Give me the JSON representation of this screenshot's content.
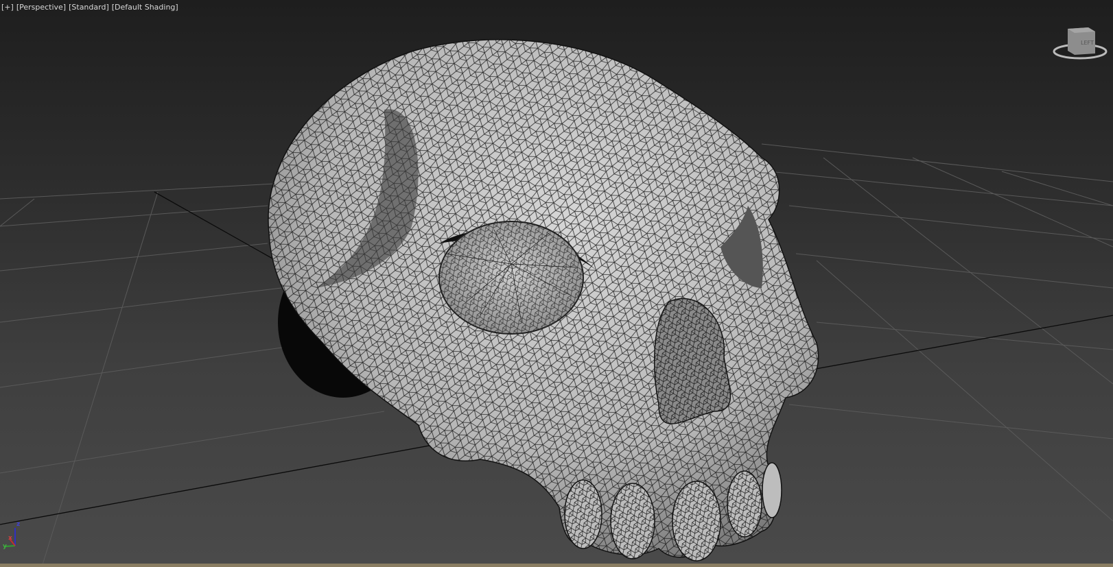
{
  "viewport": {
    "labels": [
      "[+]",
      "[Perspective]",
      "[Standard]",
      "[Default Shading]"
    ],
    "viewcube_face": "LEFT",
    "axis_labels": {
      "x": "x",
      "y": "y",
      "z": "z"
    }
  },
  "colors": {
    "mesh_fill": "#bdbdbd",
    "wire": "#111111",
    "grid": "#5c5c5c",
    "axis_x": "#c03030",
    "axis_y": "#30a030",
    "axis_z": "#3030c0"
  }
}
